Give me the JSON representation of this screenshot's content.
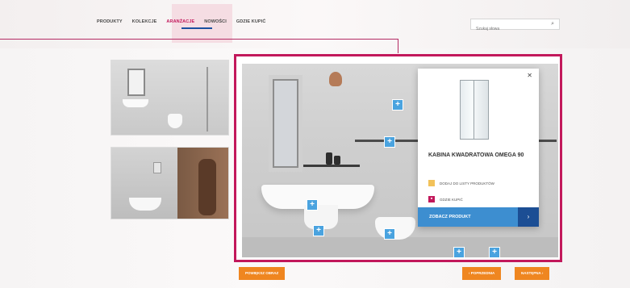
{
  "nav": {
    "items": [
      {
        "label": "PRODUKTY"
      },
      {
        "label": "KOLEKCJE"
      },
      {
        "label": "ARANŻACJE"
      },
      {
        "label": "NOWOŚCI"
      },
      {
        "label": "GDZIE KUPIĆ"
      }
    ],
    "active_index": 2
  },
  "search": {
    "placeholder": "Szukaj słowa"
  },
  "popup": {
    "product_title": "KABINA KWADRATOWA OMEGA 90",
    "add_to_list_label": "DODAJ DO LISTY PRODUKTÓW",
    "where_to_buy_label": "GDZIE KUPIĆ",
    "cta_label": "ZOBACZ PRODUKT",
    "cta_arrow": "›"
  },
  "hotspots": [
    "+",
    "+",
    "+",
    "+",
    "+",
    "+",
    "+"
  ],
  "buttons": {
    "zoom_label": "POWIĘKSZ OBRAZ",
    "prev_label": "‹ POPRZEDNIA",
    "next_label": "NASTĘPNA ›"
  },
  "colors": {
    "accent": "#c2185b",
    "cta": "#3d8ed0",
    "cta_dark": "#1c4e94",
    "orange": "#ef8620"
  }
}
